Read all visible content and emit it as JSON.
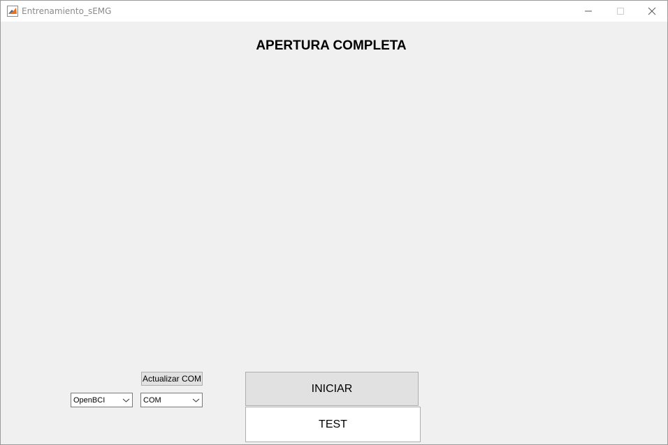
{
  "window": {
    "title": "Entrenamiento_sEMG",
    "icon": "matlab-icon"
  },
  "main": {
    "title": "APERTURA COMPLETA"
  },
  "controls": {
    "refresh_com_label": "Actualizar COM",
    "board_select_value": "OpenBCI",
    "com_select_value": "COM",
    "start_label": "INICIAR",
    "test_label": "TEST"
  }
}
